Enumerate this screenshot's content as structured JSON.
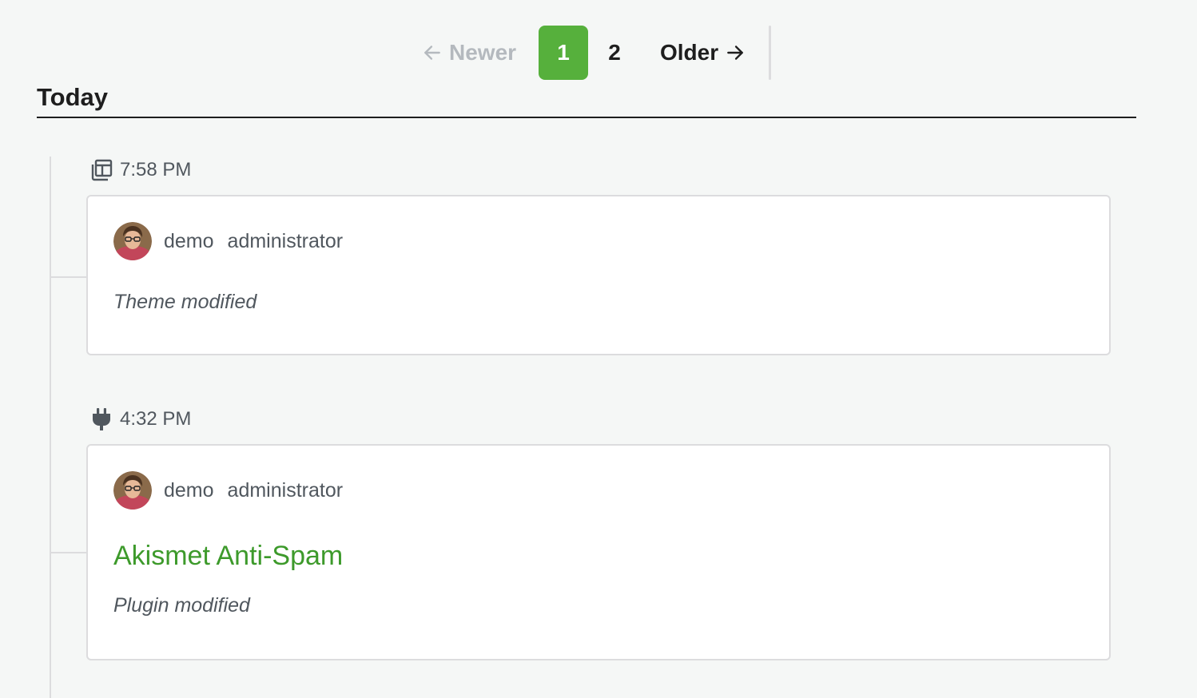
{
  "pagination": {
    "newer_label": "Newer",
    "pages": [
      "1",
      "2"
    ],
    "current_page": "1",
    "older_label": "Older"
  },
  "day_heading": "Today",
  "entries": [
    {
      "time": "7:58 PM",
      "icon": "theme-icon",
      "user": "demo",
      "role": "administrator",
      "object": "",
      "action": "Theme modified"
    },
    {
      "time": "4:32 PM",
      "icon": "plug-icon",
      "user": "demo",
      "role": "administrator",
      "object": "Akismet Anti-Spam",
      "action": "Plugin modified"
    }
  ],
  "colors": {
    "accent_green": "#56b03c",
    "link_green": "#3d9a2b",
    "background": "#f5f7f6"
  }
}
